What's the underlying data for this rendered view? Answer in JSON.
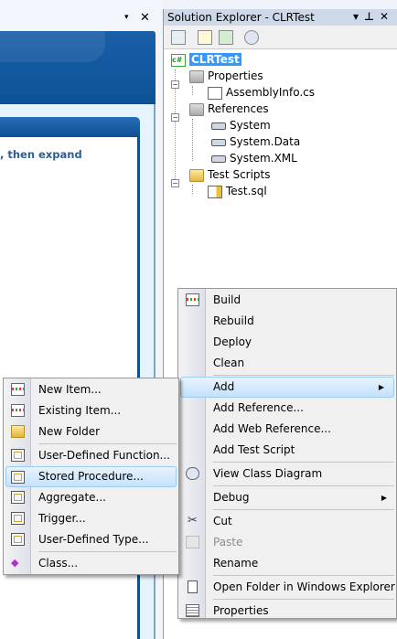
{
  "left_pane": {
    "close": "✕",
    "dropdown": "▾",
    "panel_text": ", then expand"
  },
  "solution_explorer": {
    "title": "Solution Explorer - CLRTest",
    "controls": {
      "dropdown": "▾",
      "pin": "⊥",
      "close": "✕"
    },
    "toolbar": [
      "properties-icon",
      "show-all-files-icon",
      "refresh-icon",
      "view-class-diagram-icon"
    ],
    "tree": {
      "root": "CLRTest",
      "properties": "Properties",
      "assemblyinfo": "AssemblyInfo.cs",
      "references": "References",
      "refs": [
        "System",
        "System.Data",
        "System.XML"
      ],
      "test_scripts": "Test Scripts",
      "test_sql": "Test.sql"
    }
  },
  "context_menu": {
    "items": [
      {
        "label": "Build",
        "icon": "build-icon"
      },
      {
        "label": "Rebuild"
      },
      {
        "label": "Deploy"
      },
      {
        "label": "Clean"
      },
      {
        "label": "Add",
        "submenu": true,
        "highlighted": true
      },
      {
        "label": "Add Reference..."
      },
      {
        "label": "Add Web Reference..."
      },
      {
        "label": "Add Test Script"
      },
      {
        "label": "View Class Diagram",
        "icon": "class-diagram-icon"
      },
      {
        "label": "Debug",
        "submenu": true
      },
      {
        "label": "Cut",
        "icon": "scissors-icon"
      },
      {
        "label": "Paste",
        "icon": "paste-icon",
        "disabled": true
      },
      {
        "label": "Rename"
      },
      {
        "label": "Open Folder in Windows Explorer",
        "icon": "open-folder-icon"
      },
      {
        "label": "Properties",
        "icon": "properties-icon"
      }
    ],
    "arrow": "▶"
  },
  "add_submenu": {
    "items": [
      {
        "label": "New Item...",
        "icon": "new-item-icon"
      },
      {
        "label": "Existing Item...",
        "icon": "existing-item-icon"
      },
      {
        "label": "New Folder",
        "icon": "new-folder-icon"
      },
      {
        "label": "User-Defined Function...",
        "icon": "database-item-icon"
      },
      {
        "label": "Stored Procedure...",
        "icon": "database-item-icon",
        "highlighted": true
      },
      {
        "label": "Aggregate...",
        "icon": "database-item-icon"
      },
      {
        "label": "Trigger...",
        "icon": "database-item-icon"
      },
      {
        "label": "User-Defined Type...",
        "icon": "database-item-icon"
      },
      {
        "label": "Class...",
        "icon": "class-icon"
      }
    ]
  },
  "colors": {
    "highlight": "#c4e2fb",
    "selection": "#3399ff",
    "banner": "#0b5296"
  }
}
